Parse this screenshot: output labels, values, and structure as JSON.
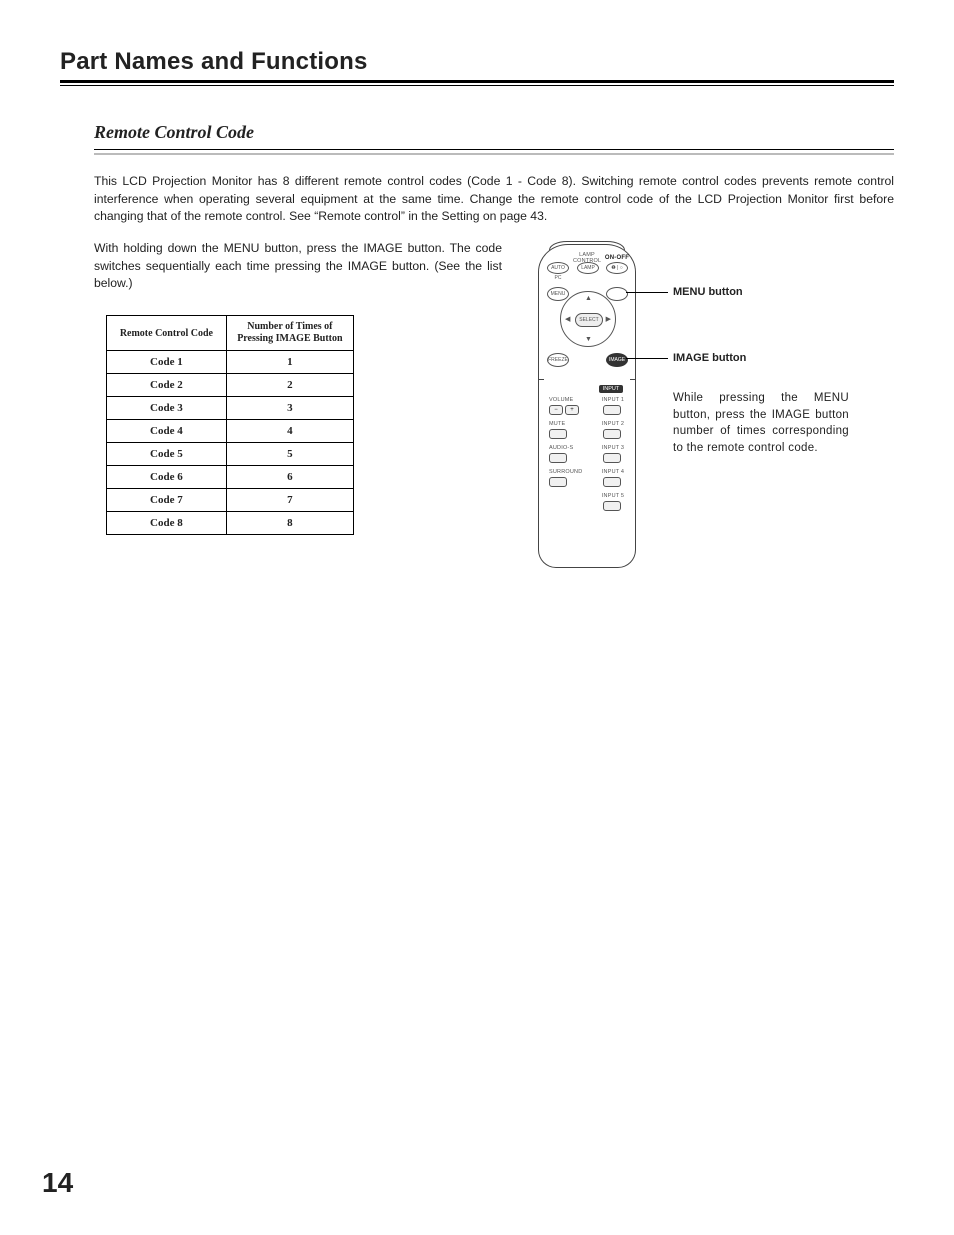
{
  "chapter_title": "Part Names and Functions",
  "section_title": "Remote Control Code",
  "intro_paragraph": "This LCD Projection Monitor has 8 different remote control codes  (Code 1 - Code 8). Switching remote control codes prevents remote control interference when operating several equipment at the same time.  Change the remote control code of the LCD Projection Monitor first before changing that of the remote control.  See “Remote control” in the Setting on page 43.",
  "instruction_paragraph": "With holding down the MENU button, press the IMAGE button.  The code switches sequentially each time pressing the IMAGE button.  (See the list below.)",
  "table": {
    "header_col1": "Remote Control Code",
    "header_col2": "Number of Times of Pressing IMAGE Button",
    "rows": [
      {
        "code": "Code 1",
        "presses": "1"
      },
      {
        "code": "Code 2",
        "presses": "2"
      },
      {
        "code": "Code 3",
        "presses": "3"
      },
      {
        "code": "Code 4",
        "presses": "4"
      },
      {
        "code": "Code 5",
        "presses": "5"
      },
      {
        "code": "Code 6",
        "presses": "6"
      },
      {
        "code": "Code 7",
        "presses": "7"
      },
      {
        "code": "Code 8",
        "presses": "8"
      }
    ]
  },
  "callouts": {
    "menu": "MENU button",
    "image": "IMAGE button",
    "help": "While pressing the MENU button, press the IMAGE button number of times corresponding to the remote control code."
  },
  "remote_labels": {
    "autopc": "AUTO PC",
    "lamp_control": "LAMP CONTROL",
    "lamp": "LAMP",
    "onoff": "ON-OFF",
    "onoff_sym": "❶ | ○",
    "menu": "MENU",
    "select": "SELECT",
    "freeze": "FREEZE",
    "image": "IMAGE",
    "input": "INPUT",
    "volume": "VOLUME",
    "mute": "MUTE",
    "audio_s": "AUDIO-S",
    "surround": "SURROUND",
    "input1": "INPUT 1",
    "input2": "INPUT 2",
    "input3": "INPUT 3",
    "input4": "INPUT 4",
    "input5": "INPUT 5",
    "minus": "−",
    "plus": "+",
    "up": "▲",
    "down": "▼",
    "left": "◀",
    "right": "▶"
  },
  "page_number": "14"
}
